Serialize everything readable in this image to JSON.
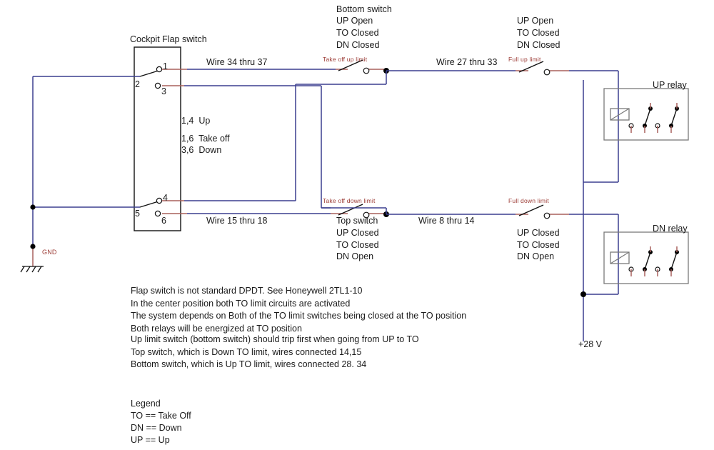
{
  "diagram": {
    "title_visible": false,
    "colors": {
      "wire_blue": "#3b3f8f",
      "wire_red": "#a9605c",
      "label_red": "#9c3b35",
      "ink": "#1a1a1a",
      "relay_box": "#7a7a7a"
    }
  },
  "cockpit_switch": {
    "title": "Cockpit Flap switch",
    "terminals": {
      "t1": "1",
      "t2": "2",
      "t3": "3",
      "t4": "4",
      "t5": "5",
      "t6": "6"
    },
    "position_table": [
      "1,4  Up",
      "1,6  Take off",
      "3,6  Down"
    ]
  },
  "wires": {
    "upper_left": "Wire 34 thru 37",
    "upper_right": "Wire 27 thru 33",
    "lower_left": "Wire 15 thru 18",
    "lower_right": "Wire 8 thru 14"
  },
  "limit_switches": {
    "take_off_up": "Take off up limit",
    "take_off_down": "Take off down limit",
    "full_up": "Full up limit",
    "full_down": "Full down limit"
  },
  "bottom_switch": {
    "name": "Bottom switch",
    "states": [
      "UP Open",
      "TO Closed",
      "DN Closed"
    ]
  },
  "top_switch": {
    "name": "Top switch",
    "states": [
      "UP Closed",
      "TO Closed",
      "DN Open"
    ]
  },
  "full_up_states": [
    "UP Open",
    "TO Closed",
    "DN Closed"
  ],
  "full_down_states": [
    "UP Closed",
    "TO Closed",
    "DN Open"
  ],
  "relays": {
    "up": "UP relay",
    "dn": "DN relay"
  },
  "power": {
    "supply": "+28 V",
    "ground": "GND"
  },
  "notes": [
    "Flap switch is not standard DPDT. See Honeywell 2TL1-10",
    "In the center position both TO limit circuits are activated",
    "The system depends on Both of the TO limit switches being closed at the TO position",
    "Both relays will be energized at TO position",
    "Up limit switch (bottom switch) should trip first when going from UP to TO",
    "Top switch, which is Down TO limit, wires connected 14,15",
    "Bottom switch, which is Up TO limit, wires connected 28. 34"
  ],
  "legend": {
    "title": "Legend",
    "entries": [
      "TO == Take Off",
      "DN == Down",
      "UP == Up"
    ]
  }
}
